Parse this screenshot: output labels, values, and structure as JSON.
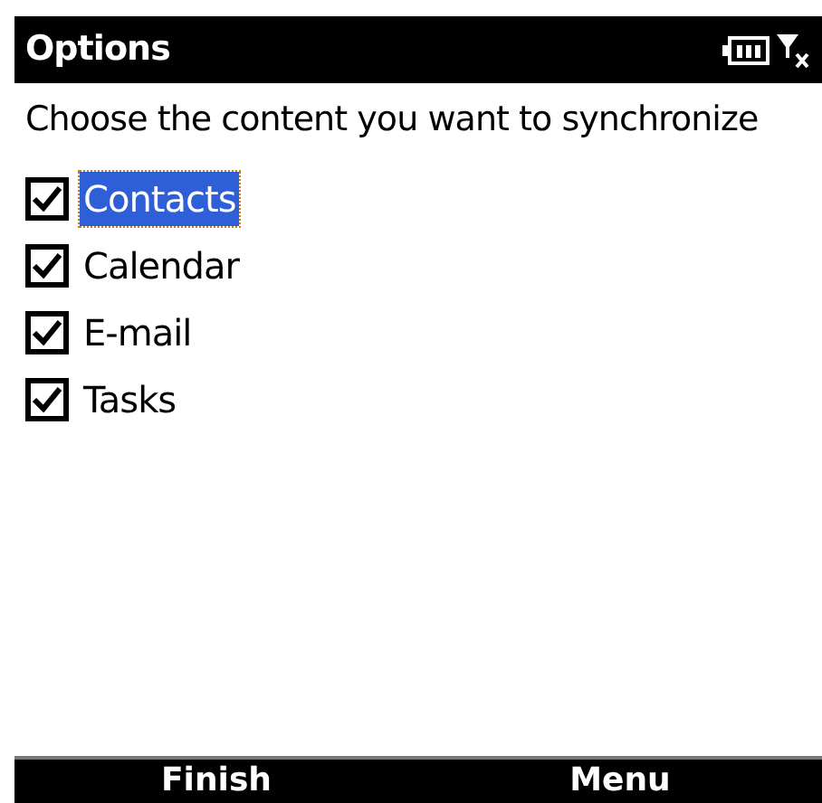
{
  "title_bar": {
    "title": "Options"
  },
  "instruction": "Choose the content you want to synchronize",
  "items": [
    {
      "label": "Contacts",
      "checked": true,
      "selected": true
    },
    {
      "label": "Calendar",
      "checked": true,
      "selected": false
    },
    {
      "label": "E-mail",
      "checked": true,
      "selected": false
    },
    {
      "label": "Tasks",
      "checked": true,
      "selected": false
    }
  ],
  "softkeys": [
    "Finish",
    "Menu"
  ]
}
